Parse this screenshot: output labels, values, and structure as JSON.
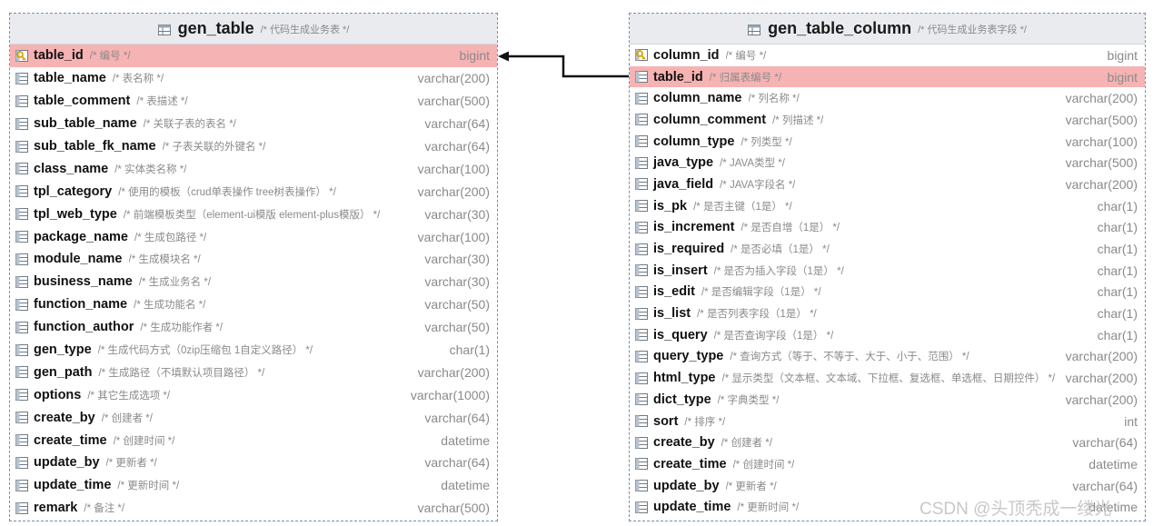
{
  "tables": [
    {
      "name": "gen_table",
      "comment": "/* 代码生成业务表 */",
      "columns": [
        {
          "name": "table_id",
          "comment": "/* 编号 */",
          "type": "bigint",
          "key": true,
          "highlight": true
        },
        {
          "name": "table_name",
          "comment": "/* 表名称 */",
          "type": "varchar(200)"
        },
        {
          "name": "table_comment",
          "comment": "/* 表描述 */",
          "type": "varchar(500)"
        },
        {
          "name": "sub_table_name",
          "comment": "/* 关联子表的表名 */",
          "type": "varchar(64)"
        },
        {
          "name": "sub_table_fk_name",
          "comment": "/* 子表关联的外键名 */",
          "type": "varchar(64)"
        },
        {
          "name": "class_name",
          "comment": "/* 实体类名称 */",
          "type": "varchar(100)"
        },
        {
          "name": "tpl_category",
          "comment": "/* 使用的模板（crud单表操作 tree树表操作） */",
          "type": "varchar(200)"
        },
        {
          "name": "tpl_web_type",
          "comment": "/* 前端模板类型（element-ui模版 element-plus模版） */",
          "type": "varchar(30)"
        },
        {
          "name": "package_name",
          "comment": "/* 生成包路径 */",
          "type": "varchar(100)"
        },
        {
          "name": "module_name",
          "comment": "/* 生成模块名 */",
          "type": "varchar(30)"
        },
        {
          "name": "business_name",
          "comment": "/* 生成业务名 */",
          "type": "varchar(30)"
        },
        {
          "name": "function_name",
          "comment": "/* 生成功能名 */",
          "type": "varchar(50)"
        },
        {
          "name": "function_author",
          "comment": "/* 生成功能作者 */",
          "type": "varchar(50)"
        },
        {
          "name": "gen_type",
          "comment": "/* 生成代码方式（0zip压缩包 1自定义路径） */",
          "type": "char(1)"
        },
        {
          "name": "gen_path",
          "comment": "/* 生成路径（不填默认项目路径） */",
          "type": "varchar(200)"
        },
        {
          "name": "options",
          "comment": "/* 其它生成选项 */",
          "type": "varchar(1000)"
        },
        {
          "name": "create_by",
          "comment": "/* 创建者 */",
          "type": "varchar(64)"
        },
        {
          "name": "create_time",
          "comment": "/* 创建时间 */",
          "type": "datetime"
        },
        {
          "name": "update_by",
          "comment": "/* 更新者 */",
          "type": "varchar(64)"
        },
        {
          "name": "update_time",
          "comment": "/* 更新时间 */",
          "type": "datetime"
        },
        {
          "name": "remark",
          "comment": "/* 备注 */",
          "type": "varchar(500)"
        }
      ]
    },
    {
      "name": "gen_table_column",
      "comment": "/* 代码生成业务表字段 */",
      "columns": [
        {
          "name": "column_id",
          "comment": "/* 编号 */",
          "type": "bigint",
          "key": true
        },
        {
          "name": "table_id",
          "comment": "/* 归属表编号 */",
          "type": "bigint",
          "highlight": true
        },
        {
          "name": "column_name",
          "comment": "/* 列名称 */",
          "type": "varchar(200)"
        },
        {
          "name": "column_comment",
          "comment": "/* 列描述 */",
          "type": "varchar(500)"
        },
        {
          "name": "column_type",
          "comment": "/* 列类型 */",
          "type": "varchar(100)"
        },
        {
          "name": "java_type",
          "comment": "/* JAVA类型 */",
          "type": "varchar(500)"
        },
        {
          "name": "java_field",
          "comment": "/* JAVA字段名 */",
          "type": "varchar(200)"
        },
        {
          "name": "is_pk",
          "comment": "/* 是否主键（1是） */",
          "type": "char(1)"
        },
        {
          "name": "is_increment",
          "comment": "/* 是否自增（1是） */",
          "type": "char(1)"
        },
        {
          "name": "is_required",
          "comment": "/* 是否必填（1是） */",
          "type": "char(1)"
        },
        {
          "name": "is_insert",
          "comment": "/* 是否为插入字段（1是） */",
          "type": "char(1)"
        },
        {
          "name": "is_edit",
          "comment": "/* 是否编辑字段（1是） */",
          "type": "char(1)"
        },
        {
          "name": "is_list",
          "comment": "/* 是否列表字段（1是） */",
          "type": "char(1)"
        },
        {
          "name": "is_query",
          "comment": "/* 是否查询字段（1是） */",
          "type": "char(1)"
        },
        {
          "name": "query_type",
          "comment": "/* 查询方式（等于、不等于、大于、小于、范围） */",
          "type": "varchar(200)"
        },
        {
          "name": "html_type",
          "comment": "/* 显示类型（文本框、文本域、下拉框、复选框、单选框、日期控件） */",
          "type": "varchar(200)"
        },
        {
          "name": "dict_type",
          "comment": "/* 字典类型 */",
          "type": "varchar(200)"
        },
        {
          "name": "sort",
          "comment": "/* 排序 */",
          "type": "int"
        },
        {
          "name": "create_by",
          "comment": "/* 创建者 */",
          "type": "varchar(64)"
        },
        {
          "name": "create_time",
          "comment": "/* 创建时间 */",
          "type": "datetime"
        },
        {
          "name": "update_by",
          "comment": "/* 更新者 */",
          "type": "varchar(64)"
        },
        {
          "name": "update_time",
          "comment": "/* 更新时间 */",
          "type": "datetime"
        }
      ]
    }
  ],
  "watermark": "CSDN @头顶秃成一缕光",
  "colors": {
    "highlight": "#f6b3b3",
    "border": "#6f8fb5",
    "header": "#e9ebee",
    "key": "#d9a400"
  }
}
